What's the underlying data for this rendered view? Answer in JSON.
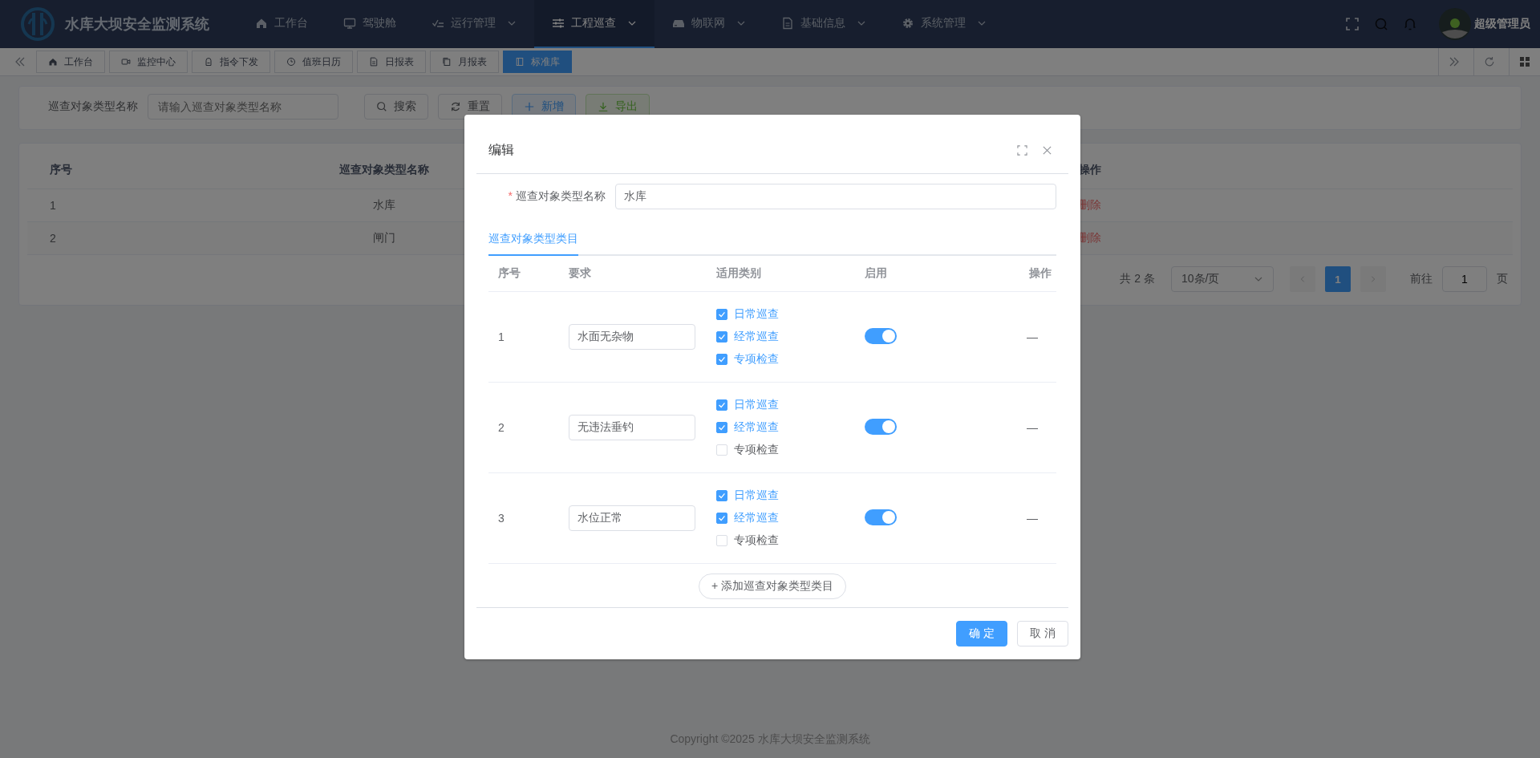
{
  "header": {
    "title": "水库大坝安全监测系统",
    "nav": [
      {
        "label": "工作台",
        "dropdown": false,
        "selected": false
      },
      {
        "label": "驾驶舱",
        "dropdown": false,
        "selected": false
      },
      {
        "label": "运行管理",
        "dropdown": true,
        "selected": false
      },
      {
        "label": "工程巡查",
        "dropdown": true,
        "selected": true
      },
      {
        "label": "物联网",
        "dropdown": true,
        "selected": false
      },
      {
        "label": "基础信息",
        "dropdown": true,
        "selected": false
      },
      {
        "label": "系统管理",
        "dropdown": true,
        "selected": false
      }
    ],
    "user": {
      "name": "超级管理员"
    }
  },
  "tags_view": {
    "tabs": [
      {
        "label": "工作台",
        "selected": false
      },
      {
        "label": "监控中心",
        "selected": false
      },
      {
        "label": "指令下发",
        "selected": false
      },
      {
        "label": "值班日历",
        "selected": false
      },
      {
        "label": "日报表",
        "selected": false
      },
      {
        "label": "月报表",
        "selected": false
      },
      {
        "label": "标准库",
        "selected": true
      }
    ]
  },
  "filter": {
    "label": "巡查对象类型名称",
    "placeholder": "请输入巡查对象类型名称",
    "buttons": [
      {
        "label": "搜索",
        "kind": "search"
      },
      {
        "label": "重置",
        "kind": "reset"
      },
      {
        "label": "新增",
        "kind": "add"
      },
      {
        "label": "导出",
        "kind": "export"
      }
    ]
  },
  "table": {
    "columns": [
      "序号",
      "巡查对象类型名称",
      "操作"
    ],
    "rows": [
      {
        "index": "1",
        "name": "水库",
        "action": "删除"
      },
      {
        "index": "2",
        "name": "闸门",
        "action": "删除"
      }
    ]
  },
  "pagination": {
    "total": "共 2 条",
    "page_size": "10条/页",
    "pages": [
      {
        "label": "1",
        "selected": true
      }
    ],
    "goto_label": "前往",
    "goto_value": "1",
    "page_suffix": "页"
  },
  "dialog": {
    "title": "编辑",
    "field": {
      "label": "巡查对象类型名称",
      "required_mark": "*",
      "value": "水库"
    },
    "tabs": [
      {
        "label": "巡查对象类型类目",
        "selected": true
      }
    ],
    "columns": [
      "序号",
      "要求",
      "适用类别",
      "启用",
      "操作"
    ],
    "rows": [
      {
        "index": "1",
        "requirement": "水面无杂物",
        "categories": [
          {
            "label": "日常巡查",
            "checked": true
          },
          {
            "label": "经常巡查",
            "checked": true
          },
          {
            "label": "专项检查",
            "checked": true
          }
        ],
        "enabled": true,
        "action": "—"
      },
      {
        "index": "2",
        "requirement": "无违法垂钓",
        "categories": [
          {
            "label": "日常巡查",
            "checked": true
          },
          {
            "label": "经常巡查",
            "checked": true
          },
          {
            "label": "专项检查",
            "checked": false
          }
        ],
        "enabled": true,
        "action": "—"
      },
      {
        "index": "3",
        "requirement": "水位正常",
        "categories": [
          {
            "label": "日常巡查",
            "checked": true
          },
          {
            "label": "经常巡查",
            "checked": true
          },
          {
            "label": "专项检查",
            "checked": false
          }
        ],
        "enabled": true,
        "action": "—"
      }
    ],
    "add_button": "+ 添加巡查对象类型类目",
    "buttons": [
      {
        "label": "确 定",
        "kind": "primary"
      },
      {
        "label": "取 消",
        "kind": "default"
      }
    ]
  },
  "footer": "Copyright ©2025 水库大坝安全监测系统"
}
